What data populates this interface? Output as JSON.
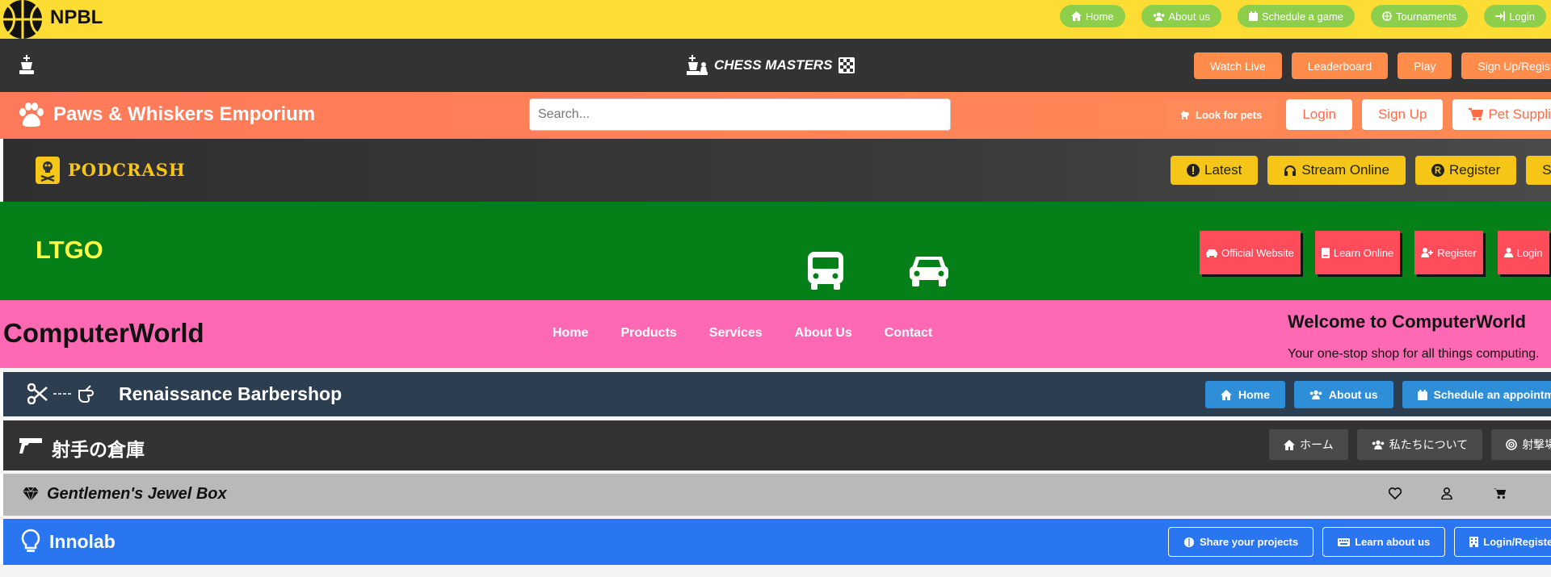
{
  "npbl": {
    "title": "NPBL",
    "nav": [
      {
        "label": "Home",
        "icon": "home-icon"
      },
      {
        "label": "About us",
        "icon": "users-icon"
      },
      {
        "label": "Schedule a game",
        "icon": "calendar-icon"
      },
      {
        "label": "Tournaments",
        "icon": "basketball-icon"
      },
      {
        "label": "Login",
        "icon": "login-icon"
      }
    ],
    "colors": {
      "bg": "#fddd33",
      "button": "#8dcf4a"
    }
  },
  "chess": {
    "title": "CHESS MASTERS",
    "nav": [
      "Watch Live",
      "Leaderboard",
      "Play",
      "Sign Up/Register"
    ],
    "colors": {
      "bg": "#333333",
      "button": "#ff8c4a"
    }
  },
  "paws": {
    "title": "Paws & Whiskers Emporium",
    "search": {
      "placeholder": "Search..."
    },
    "nav": [
      {
        "label": "Look for pets",
        "icon": "dog-icon"
      },
      {
        "label": "Login"
      },
      {
        "label": "Sign Up"
      },
      {
        "label": "Pet Supplies",
        "icon": "cart-icon"
      }
    ],
    "colors": {
      "bg": "#ff7a5a",
      "accent": "#ff6b47"
    }
  },
  "podcrash": {
    "title": "PODCRASH",
    "nav": [
      {
        "label": "Latest",
        "icon": "exclamation-icon"
      },
      {
        "label": "Stream Online",
        "icon": "headphones-icon"
      },
      {
        "label": "Register",
        "icon": "registered-icon"
      },
      {
        "label": "Sign"
      }
    ],
    "colors": {
      "bg": "#333333",
      "accent": "#f5c518"
    }
  },
  "ltgo": {
    "title": "LTGO",
    "nav": [
      {
        "label": "Official Website",
        "icon": "car-icon"
      },
      {
        "label": "Learn Online",
        "icon": "book-icon"
      },
      {
        "label": "Register",
        "icon": "user-plus-icon"
      },
      {
        "label": "Login",
        "icon": "user-icon"
      }
    ],
    "colors": {
      "bg": "#058018",
      "title": "#ffff44",
      "button": "#ff4c5a"
    }
  },
  "computerworld": {
    "title": "ComputerWorld",
    "nav": [
      "Home",
      "Products",
      "Services",
      "About Us",
      "Contact"
    ],
    "welcome": "Welcome to ComputerWorld",
    "tagline": "Your one-stop shop for all things computing.",
    "colors": {
      "bg": "#ff69b4"
    }
  },
  "barber": {
    "title": "Renaissance Barbershop",
    "nav": [
      {
        "label": "Home",
        "icon": "home-icon"
      },
      {
        "label": "About us",
        "icon": "users-icon"
      },
      {
        "label": "Schedule an appointment",
        "icon": "calendar-icon"
      }
    ],
    "colors": {
      "bg": "#2c3e50",
      "button": "#2e8fd8"
    }
  },
  "shooter": {
    "title": "射手の倉庫",
    "nav": [
      {
        "label": "ホーム",
        "icon": "home-icon"
      },
      {
        "label": "私たちについて",
        "icon": "users-icon"
      },
      {
        "label": "射撃場",
        "icon": "target-icon"
      }
    ],
    "colors": {
      "bg": "#333333",
      "button": "#4a4a4a"
    }
  },
  "jewel": {
    "title": "Gentlemen's Jewel Box",
    "icons": [
      "heart-icon",
      "user-icon",
      "cart-icon"
    ],
    "colors": {
      "bg": "#b9b9b9"
    }
  },
  "innolab": {
    "title": "Innolab",
    "nav": [
      {
        "label": "Share your projects",
        "icon": "brain-icon"
      },
      {
        "label": "Learn about us",
        "icon": "keyboard-icon"
      },
      {
        "label": "Login/Register",
        "icon": "building-icon"
      }
    ],
    "colors": {
      "bg": "#2a75f0"
    }
  }
}
